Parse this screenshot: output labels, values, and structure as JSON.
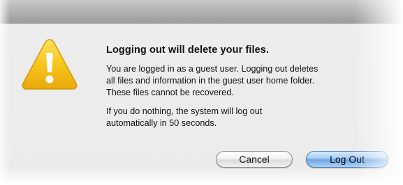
{
  "dialog": {
    "headline": "Logging out will delete your files.",
    "message": "You are logged in as a guest user. Logging out deletes\nall files and information in the guest user home folder.\nThese files cannot be recovered.",
    "countdown_message": "If you do nothing, the system will log out\nautomatically in 50 seconds.",
    "icon": "warning-triangle-icon",
    "colors": {
      "icon_fill": "#f5c21a",
      "default_button": "#6fa8e4"
    }
  },
  "buttons": {
    "cancel_label": "Cancel",
    "logout_label": "Log Out"
  }
}
